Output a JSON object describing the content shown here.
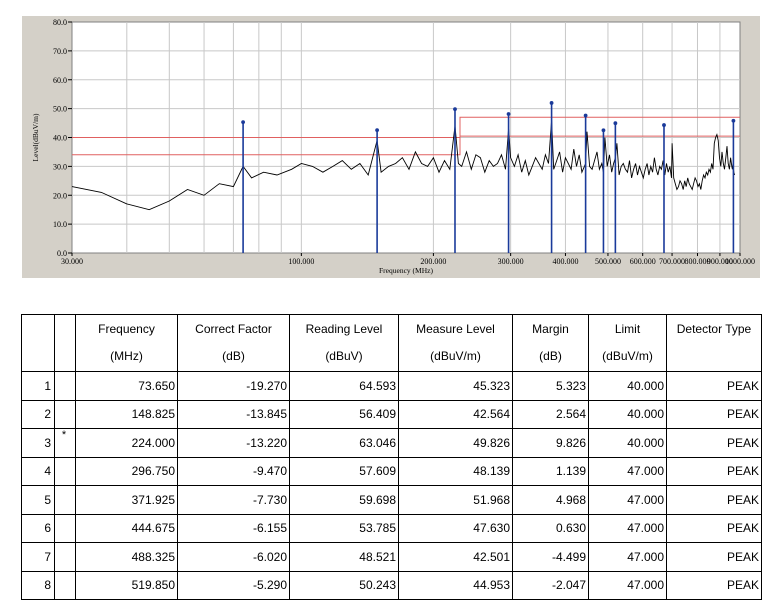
{
  "chart_data": {
    "type": "line",
    "ylabel": "Level(dBuV/m)",
    "xlabel": "Frequency (MHz)",
    "ylim": [
      0,
      80
    ],
    "xlim": [
      30,
      1000
    ],
    "y_ticks": [
      "0.0",
      "10.0",
      "20.0",
      "30.0",
      "40.0",
      "50.0",
      "60.0",
      "70.0",
      "80.0"
    ],
    "y_tick_values": [
      0,
      10,
      20,
      30,
      40,
      50,
      60,
      70,
      80
    ],
    "x_ticks": [
      "30.000",
      "100.000",
      "200.000",
      "300.000",
      "400.000",
      "500.000",
      "600.000",
      "700.000",
      "800.000",
      "900.000",
      "1000.000"
    ],
    "x_tick_values": [
      30,
      100,
      200,
      300,
      400,
      500,
      600,
      700,
      800,
      900,
      1000
    ],
    "grid": true,
    "colors": {
      "trace": "#000000",
      "limit": "#e06060",
      "marker": "#1a3a9a",
      "plot_bg": "#ffffff",
      "grid": "#c8c8c8",
      "panel": "#d4d0c8"
    },
    "limit_lines": [
      {
        "x": [
          30,
          230,
          230,
          1000
        ],
        "y": [
          40,
          40,
          47,
          47
        ]
      },
      {
        "x": [
          30,
          230,
          230,
          1000
        ],
        "y": [
          34,
          34,
          40.5,
          40.5
        ]
      }
    ],
    "trace": {
      "x": [
        30,
        35,
        40,
        45,
        50,
        55,
        60,
        65,
        70,
        73.65,
        77,
        82,
        88,
        95,
        100,
        106,
        112,
        118,
        124,
        130,
        136,
        142,
        148.8,
        152,
        158,
        164,
        170,
        176,
        182,
        188,
        194,
        200,
        206,
        212,
        218,
        224,
        228,
        232,
        238,
        244,
        250,
        256,
        262,
        268,
        274,
        280,
        286,
        292,
        296.75,
        300,
        306,
        312,
        318,
        324,
        330,
        336,
        342,
        348,
        354,
        360,
        366,
        371.9,
        376,
        382,
        388,
        394,
        400,
        406,
        412,
        418,
        424,
        430,
        436,
        444.7,
        448,
        454,
        460,
        466,
        472,
        478,
        484,
        488.3,
        492,
        498,
        504,
        510,
        515,
        519.9,
        524,
        530,
        536,
        542,
        548,
        554,
        560,
        566,
        572,
        578,
        584,
        590,
        596,
        602,
        608,
        614,
        620,
        626,
        632,
        638,
        644,
        650,
        656,
        662,
        668,
        674,
        680,
        686,
        692,
        698,
        700,
        706,
        712,
        718,
        724,
        730,
        736,
        742,
        748,
        754,
        760,
        766,
        772,
        778,
        784,
        790,
        796,
        802,
        808,
        814,
        820,
        826,
        832,
        838,
        844,
        850,
        856,
        862,
        868,
        874,
        880,
        886,
        892,
        898,
        904,
        910,
        916,
        922,
        928,
        934,
        940,
        946,
        952,
        958,
        961,
        964,
        968,
        972,
        978,
        984,
        990,
        995,
        1000
      ],
      "y": [
        23,
        21,
        17,
        15,
        18,
        22,
        20,
        24,
        23,
        30,
        26,
        28,
        27,
        29,
        31,
        30,
        28,
        30,
        32,
        29,
        31,
        27,
        39,
        28,
        30,
        31,
        33,
        29,
        35,
        31,
        30,
        33,
        28,
        32,
        29,
        44,
        31,
        30,
        35,
        29,
        34,
        33,
        28,
        32,
        30,
        31,
        34,
        29,
        43,
        33,
        30,
        34,
        28,
        32,
        27,
        30,
        33,
        31,
        29,
        34,
        31,
        46,
        29,
        32,
        35,
        28,
        33,
        31,
        29,
        36,
        30,
        34,
        28,
        31,
        42,
        30,
        29,
        32,
        35,
        29,
        31,
        28,
        40,
        30,
        34,
        28,
        31,
        33,
        38,
        27,
        30,
        31,
        29,
        28,
        32,
        26,
        29,
        31,
        27,
        30,
        28,
        26,
        29,
        31,
        27,
        30,
        28,
        33,
        29,
        27,
        30,
        29,
        32,
        27,
        31,
        28,
        30,
        26,
        38,
        26,
        24,
        22,
        23,
        25,
        24,
        22,
        25,
        23,
        26,
        24,
        23,
        22,
        24,
        26,
        25,
        23,
        24,
        22,
        25,
        27,
        26,
        28,
        27,
        29,
        28,
        31,
        29,
        38,
        40,
        41,
        39,
        33,
        30,
        35,
        31,
        29,
        33,
        37,
        31,
        29,
        33,
        30,
        29,
        31,
        28,
        27
      ]
    },
    "peaks": [
      {
        "x": 73.65,
        "y": 45.323
      },
      {
        "x": 148.825,
        "y": 42.564
      },
      {
        "x": 224.0,
        "y": 49.826
      },
      {
        "x": 296.75,
        "y": 48.139
      },
      {
        "x": 371.925,
        "y": 51.968
      },
      {
        "x": 444.675,
        "y": 47.63
      },
      {
        "x": 488.325,
        "y": 42.501
      },
      {
        "x": 519.85,
        "y": 44.953
      },
      {
        "x": 671.0,
        "y": 44.3
      },
      {
        "x": 966.0,
        "y": 45.8
      }
    ]
  },
  "table": {
    "headers": [
      {
        "l1": "",
        "l2": ""
      },
      {
        "l1": "",
        "l2": ""
      },
      {
        "l1": "Frequency",
        "l2": "(MHz)"
      },
      {
        "l1": "Correct Factor",
        "l2": "(dB)"
      },
      {
        "l1": "Reading Level",
        "l2": "(dBuV)"
      },
      {
        "l1": "Measure Level",
        "l2": "(dBuV/m)"
      },
      {
        "l1": "Margin",
        "l2": "(dB)"
      },
      {
        "l1": "Limit",
        "l2": "(dBuV/m)"
      },
      {
        "l1": "Detector Type",
        "l2": ""
      }
    ],
    "rows": [
      {
        "idx": "1",
        "mark": "",
        "freq": "73.650",
        "cf": "-19.270",
        "read": "64.593",
        "meas": "45.323",
        "margin": "5.323",
        "limit": "40.000",
        "det": "PEAK"
      },
      {
        "idx": "2",
        "mark": "",
        "freq": "148.825",
        "cf": "-13.845",
        "read": "56.409",
        "meas": "42.564",
        "margin": "2.564",
        "limit": "40.000",
        "det": "PEAK"
      },
      {
        "idx": "3",
        "mark": "*",
        "freq": "224.000",
        "cf": "-13.220",
        "read": "63.046",
        "meas": "49.826",
        "margin": "9.826",
        "limit": "40.000",
        "det": "PEAK"
      },
      {
        "idx": "4",
        "mark": "",
        "freq": "296.750",
        "cf": "-9.470",
        "read": "57.609",
        "meas": "48.139",
        "margin": "1.139",
        "limit": "47.000",
        "det": "PEAK"
      },
      {
        "idx": "5",
        "mark": "",
        "freq": "371.925",
        "cf": "-7.730",
        "read": "59.698",
        "meas": "51.968",
        "margin": "4.968",
        "limit": "47.000",
        "det": "PEAK"
      },
      {
        "idx": "6",
        "mark": "",
        "freq": "444.675",
        "cf": "-6.155",
        "read": "53.785",
        "meas": "47.630",
        "margin": "0.630",
        "limit": "47.000",
        "det": "PEAK"
      },
      {
        "idx": "7",
        "mark": "",
        "freq": "488.325",
        "cf": "-6.020",
        "read": "48.521",
        "meas": "42.501",
        "margin": "-4.499",
        "limit": "47.000",
        "det": "PEAK"
      },
      {
        "idx": "8",
        "mark": "",
        "freq": "519.850",
        "cf": "-5.290",
        "read": "50.243",
        "meas": "44.953",
        "margin": "-2.047",
        "limit": "47.000",
        "det": "PEAK"
      }
    ]
  }
}
